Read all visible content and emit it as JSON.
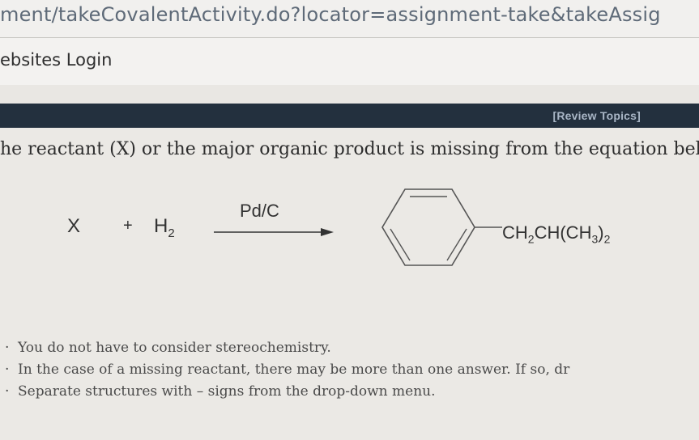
{
  "browser": {
    "url_fragment": "ment/takeCovalentActivity.do?locator=assignment-take&takeAssig",
    "bookmark": "ebsites Login"
  },
  "header": {
    "review_topics": "[Review Topics]"
  },
  "question": {
    "prompt": "he reactant (X) or the major organic product is missing from the equation belo"
  },
  "equation": {
    "reactant": "X",
    "plus": "+",
    "reagent_symbol": "H",
    "reagent_subscript": "2",
    "catalyst": "Pd/C",
    "product_substituent": {
      "p1": "CH",
      "s1": "2",
      "p2": "CH(CH",
      "s2": "3",
      "p3": ")",
      "s3": "2"
    }
  },
  "instructions": [
    "You do not have to consider stereochemistry.",
    "In the case of a missing reactant, there may be more than one answer. If so, dr",
    "Separate structures with – signs from the drop-down menu."
  ],
  "colors": {
    "header_bar": "#23303e",
    "review_link": "#a9b6c6",
    "url_text": "#5e6a78"
  }
}
